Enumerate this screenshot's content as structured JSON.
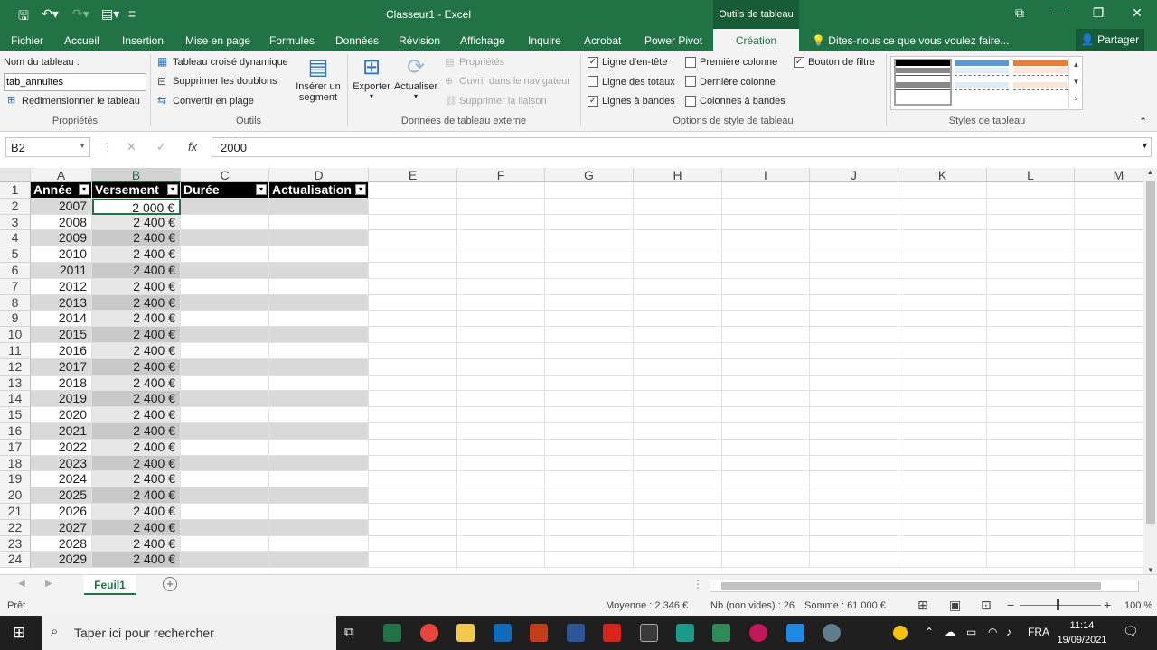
{
  "titlebar": {
    "doc_title": "Classeur1 - Excel",
    "context_tools": "Outils de tableau"
  },
  "tabs": [
    "Fichier",
    "Accueil",
    "Insertion",
    "Mise en page",
    "Formules",
    "Données",
    "Révision",
    "Affichage",
    "Inquire",
    "Acrobat",
    "Power Pivot",
    "Création"
  ],
  "tell_me": "Dites-nous ce que vous voulez faire...",
  "share": "Partager",
  "ribbon": {
    "properties": {
      "name_label": "Nom du tableau :",
      "name_value": "tab_annuites",
      "resize": "Redimensionner le tableau",
      "label": "Propriétés"
    },
    "tools": {
      "pivot": "Tableau croisé dynamique",
      "dedupe": "Supprimer les doublons",
      "convert": "Convertir en plage",
      "slicer_line1": "Insérer un",
      "slicer_line2": "segment",
      "label": "Outils"
    },
    "external": {
      "export": "Exporter",
      "refresh": "Actualiser",
      "props": "Propriétés",
      "open_browser": "Ouvrir dans le navigateur",
      "unlink": "Supprimer la liaison",
      "label": "Données de tableau externe"
    },
    "style_options": {
      "header_row": "Ligne d'en-tête",
      "total_row": "Ligne des totaux",
      "banded_rows": "Lignes à bandes",
      "first_col": "Première colonne",
      "last_col": "Dernière colonne",
      "banded_cols": "Colonnes à bandes",
      "filter_btn": "Bouton de filtre",
      "label": "Options de style de tableau"
    },
    "styles_label": "Styles de tableau"
  },
  "formula_bar": {
    "name_box": "B2",
    "cancel": "✕",
    "enter": "✓",
    "fx": "fx",
    "value": "2000"
  },
  "columns": [
    "A",
    "B",
    "C",
    "D",
    "E",
    "F",
    "G",
    "H",
    "I",
    "J",
    "K",
    "L",
    "M"
  ],
  "table": {
    "headers": [
      "Année",
      "Versement",
      "Durée",
      "Actualisation"
    ],
    "rows": [
      {
        "row": "2",
        "year": "2007",
        "amount": "2 000 €"
      },
      {
        "row": "3",
        "year": "2008",
        "amount": "2 400 €"
      },
      {
        "row": "4",
        "year": "2009",
        "amount": "2 400 €"
      },
      {
        "row": "5",
        "year": "2010",
        "amount": "2 400 €"
      },
      {
        "row": "6",
        "year": "2011",
        "amount": "2 400 €"
      },
      {
        "row": "7",
        "year": "2012",
        "amount": "2 400 €"
      },
      {
        "row": "8",
        "year": "2013",
        "amount": "2 400 €"
      },
      {
        "row": "9",
        "year": "2014",
        "amount": "2 400 €"
      },
      {
        "row": "10",
        "year": "2015",
        "amount": "2 400 €"
      },
      {
        "row": "11",
        "year": "2016",
        "amount": "2 400 €"
      },
      {
        "row": "12",
        "year": "2017",
        "amount": "2 400 €"
      },
      {
        "row": "13",
        "year": "2018",
        "amount": "2 400 €"
      },
      {
        "row": "14",
        "year": "2019",
        "amount": "2 400 €"
      },
      {
        "row": "15",
        "year": "2020",
        "amount": "2 400 €"
      },
      {
        "row": "16",
        "year": "2021",
        "amount": "2 400 €"
      },
      {
        "row": "17",
        "year": "2022",
        "amount": "2 400 €"
      },
      {
        "row": "18",
        "year": "2023",
        "amount": "2 400 €"
      },
      {
        "row": "19",
        "year": "2024",
        "amount": "2 400 €"
      },
      {
        "row": "20",
        "year": "2025",
        "amount": "2 400 €"
      },
      {
        "row": "21",
        "year": "2026",
        "amount": "2 400 €"
      },
      {
        "row": "22",
        "year": "2027",
        "amount": "2 400 €"
      },
      {
        "row": "23",
        "year": "2028",
        "amount": "2 400 €"
      },
      {
        "row": "24",
        "year": "2029",
        "amount": "2 400 €"
      }
    ]
  },
  "header_row_number": "1",
  "sheet_tab": "Feuil1",
  "statusbar": {
    "ready": "Prêt",
    "average": "Moyenne : 2 346 €",
    "count": "Nb (non vides) : 26",
    "sum": "Somme : 61 000 €",
    "zoom": "100 %"
  },
  "taskbar": {
    "search_placeholder": "Taper ici pour rechercher",
    "lang": "FRA",
    "time": "11:14",
    "date": "19/09/2021"
  }
}
